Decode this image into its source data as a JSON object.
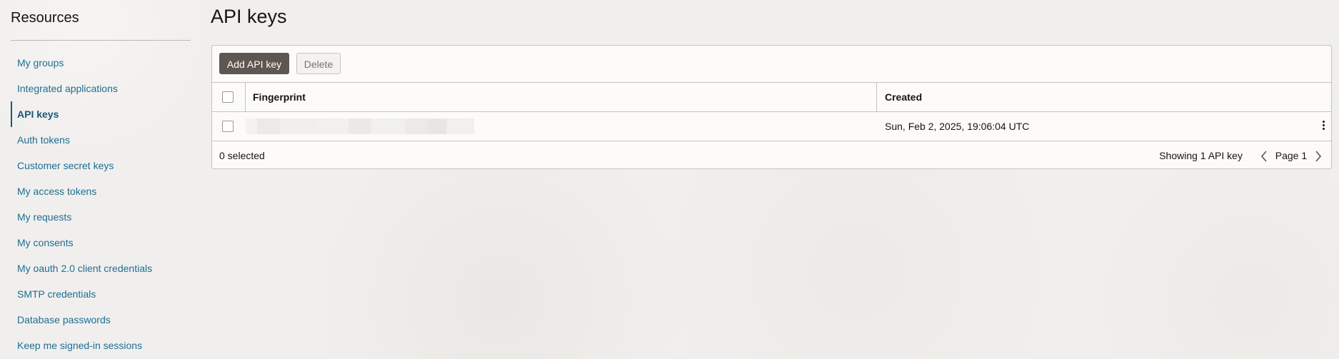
{
  "sidebar": {
    "title": "Resources",
    "items": [
      {
        "label": "My groups",
        "active": false
      },
      {
        "label": "Integrated applications",
        "active": false
      },
      {
        "label": "API keys",
        "active": true
      },
      {
        "label": "Auth tokens",
        "active": false
      },
      {
        "label": "Customer secret keys",
        "active": false
      },
      {
        "label": "My access tokens",
        "active": false
      },
      {
        "label": "My requests",
        "active": false
      },
      {
        "label": "My consents",
        "active": false
      },
      {
        "label": "My oauth 2.0 client credentials",
        "active": false
      },
      {
        "label": "SMTP credentials",
        "active": false
      },
      {
        "label": "Database passwords",
        "active": false
      },
      {
        "label": "Keep me signed-in sessions",
        "active": false
      }
    ]
  },
  "main": {
    "title": "API keys",
    "toolbar": {
      "add_label": "Add API key",
      "delete_label": "Delete"
    },
    "table": {
      "columns": [
        "Fingerprint",
        "Created"
      ],
      "rows": [
        {
          "fingerprint": "[redacted]",
          "created": "Sun, Feb 2, 2025, 19:06:04 UTC"
        }
      ]
    },
    "footer": {
      "selected": "0 selected",
      "showing": "Showing 1 API key",
      "page": "Page 1"
    }
  },
  "colors": {
    "link": "#1d6e94",
    "active_nav": "#145a7a",
    "primary_button": "#5f5551",
    "background": "#f1efed"
  },
  "icons": {
    "prev": "chevron-left-icon",
    "next": "chevron-right-icon",
    "row_actions": "kebab-menu-icon"
  }
}
